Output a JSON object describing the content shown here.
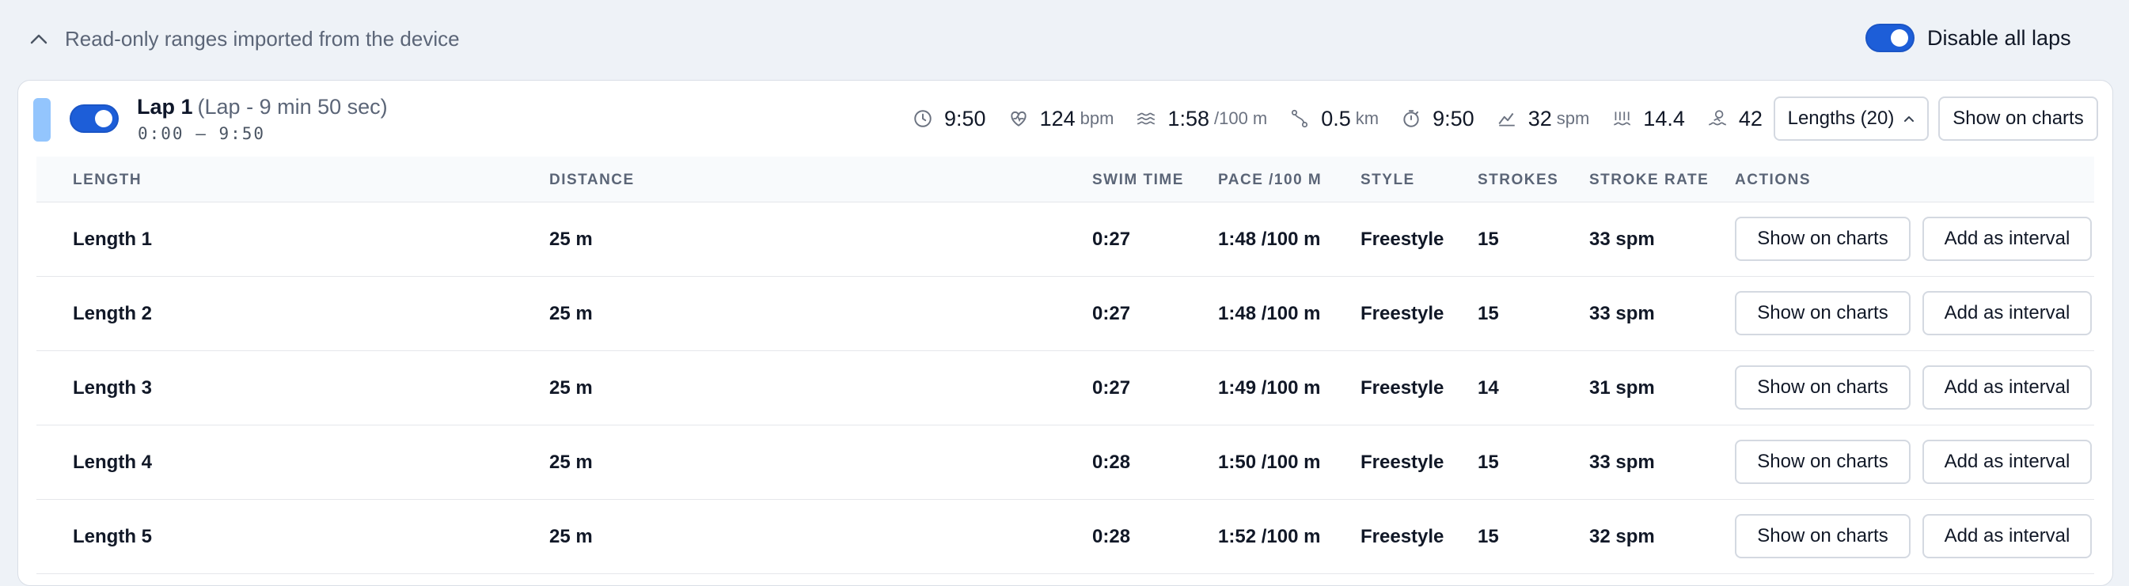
{
  "header": {
    "title": "Read-only ranges imported from the device",
    "disable_all_label": "Disable all laps"
  },
  "lap": {
    "name": "Lap 1",
    "subtitle": "(Lap - 9 min 50 sec)",
    "range": "0:00 — 9:50",
    "color": "#93c5fd",
    "enabled": true,
    "stats": {
      "duration": "9:50",
      "heart_rate": "124",
      "heart_rate_unit": "bpm",
      "pace": "1:58",
      "pace_unit": "/100 m",
      "distance": "0.5",
      "distance_unit": "km",
      "moving_time": "9:50",
      "stroke_rate": "32",
      "stroke_rate_unit": "spm",
      "swolf": "14.4",
      "strokes": "42"
    },
    "lengths_button_label": "Lengths (20)",
    "show_on_charts_label": "Show on charts"
  },
  "table": {
    "columns": {
      "length": "LENGTH",
      "distance": "DISTANCE",
      "swim_time": "SWIM TIME",
      "pace": "PACE /100 M",
      "style": "STYLE",
      "strokes": "STROKES",
      "stroke_rate": "STROKE RATE",
      "actions": "ACTIONS"
    },
    "rows": [
      {
        "length": "Length 1",
        "distance": "25 m",
        "swim_time": "0:27",
        "pace": "1:48 /100 m",
        "style": "Freestyle",
        "strokes": "15",
        "stroke_rate": "33 spm",
        "show_label": "Show on charts",
        "add_label": "Add as interval"
      },
      {
        "length": "Length 2",
        "distance": "25 m",
        "swim_time": "0:27",
        "pace": "1:48 /100 m",
        "style": "Freestyle",
        "strokes": "15",
        "stroke_rate": "33 spm",
        "show_label": "Show on charts",
        "add_label": "Add as interval"
      },
      {
        "length": "Length 3",
        "distance": "25 m",
        "swim_time": "0:27",
        "pace": "1:49 /100 m",
        "style": "Freestyle",
        "strokes": "14",
        "stroke_rate": "31 spm",
        "show_label": "Show on charts",
        "add_label": "Add as interval"
      },
      {
        "length": "Length 4",
        "distance": "25 m",
        "swim_time": "0:28",
        "pace": "1:50 /100 m",
        "style": "Freestyle",
        "strokes": "15",
        "stroke_rate": "33 spm",
        "show_label": "Show on charts",
        "add_label": "Add as interval"
      },
      {
        "length": "Length 5",
        "distance": "25 m",
        "swim_time": "0:28",
        "pace": "1:52 /100 m",
        "style": "Freestyle",
        "strokes": "15",
        "stroke_rate": "32 spm",
        "show_label": "Show on charts",
        "add_label": "Add as interval"
      }
    ]
  },
  "icons": {
    "collapse": "chevron-up-icon",
    "duration": "clock-icon",
    "heart_rate": "heart-pulse-icon",
    "pace": "waves-icon",
    "distance": "route-icon",
    "moving_time": "stopwatch-icon",
    "stroke_rate": "stroke-rate-icon",
    "swolf": "swolf-icon",
    "strokes": "swimmer-icon",
    "lengths_chevron": "chevron-up-icon"
  },
  "colors": {
    "accent": "#1d5ed8",
    "lap_color": "#93c5fd",
    "background": "#eef2f7"
  }
}
